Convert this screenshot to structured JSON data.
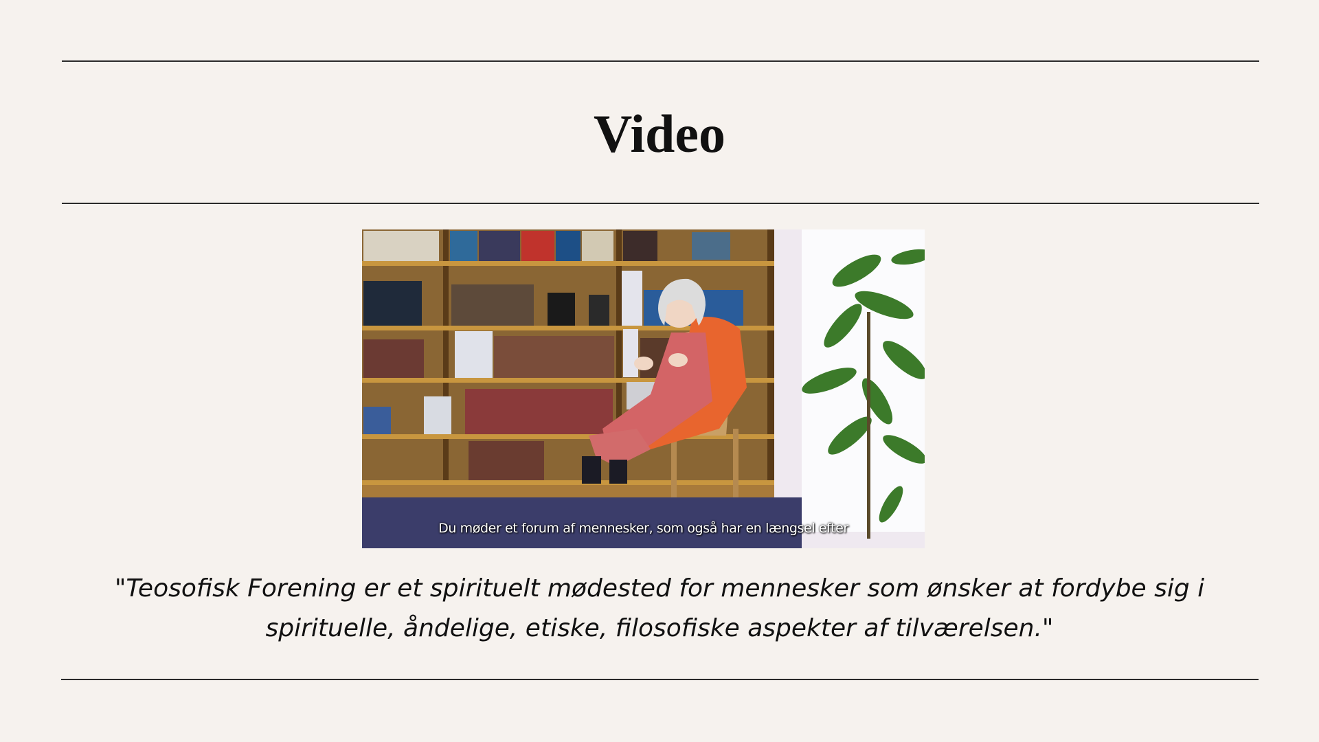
{
  "section": {
    "title": "Video"
  },
  "video": {
    "subtitle": "Du møder et forum af mennesker, som også har en længsel efter"
  },
  "quote": {
    "text": "\"Teosofisk Forening er et spirituelt mødested for mennesker som ønsker at fordybe sig i spirituelle, åndelige, etiske, filosofiske aspekter af tilværelsen.\""
  },
  "colors": {
    "background": "#f6f2ee",
    "rule": "#2a2a2a",
    "text": "#111111"
  }
}
